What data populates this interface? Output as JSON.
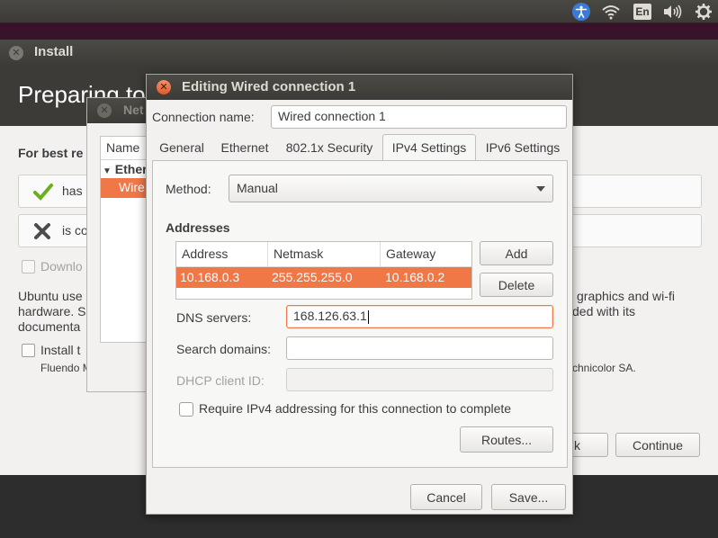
{
  "topbar": {
    "icons": [
      "accessibility-icon",
      "wifi-icon",
      "keyboard-layout-icon",
      "volume-icon",
      "gear-icon"
    ],
    "keyboard_layout": "En"
  },
  "installer": {
    "title": "Install",
    "heading": "Preparing to",
    "best_results": "For best re",
    "check1": "has",
    "check2": "is co",
    "download": "Downlo",
    "para_line1": "Ubuntu use",
    "para_line2": "hardware. S",
    "para_line3": "documenta",
    "para_right1": "graphics and wi-fi",
    "para_right2": "ded with its",
    "install_third": "Install t",
    "fluendo": "Fluendo M",
    "technicolor": "chnicolor SA.",
    "back_label": "k",
    "continue_label": "Continue"
  },
  "netwin": {
    "title": "Net",
    "col_name": "Name",
    "group": "Ether",
    "selected": "Wire"
  },
  "dialog": {
    "title": "Editing Wired connection 1",
    "connection_name_label": "Connection name:",
    "connection_name_value": "Wired connection 1",
    "tabs": [
      "General",
      "Ethernet",
      "802.1x Security",
      "IPv4 Settings",
      "IPv6 Settings"
    ],
    "active_tab": "IPv4 Settings",
    "method_label": "Method:",
    "method_value": "Manual",
    "addresses_label": "Addresses",
    "table_headers": [
      "Address",
      "Netmask",
      "Gateway"
    ],
    "rows": [
      {
        "address": "10.168.0.3",
        "netmask": "255.255.255.0",
        "gateway": "10.168.0.2"
      }
    ],
    "add_label": "Add",
    "delete_label": "Delete",
    "dns_label": "DNS servers:",
    "dns_value": "168.126.63.1",
    "search_label": "Search domains:",
    "search_value": "",
    "dhcp_label": "DHCP client ID:",
    "dhcp_value": "",
    "require_label": "Require IPv4 addressing for this connection to complete",
    "routes_label": "Routes...",
    "cancel_label": "Cancel",
    "save_label": "Save...",
    "accent_color": "#f07746"
  }
}
